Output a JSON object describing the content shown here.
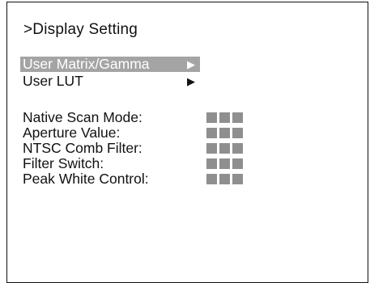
{
  "screen": {
    "title": ">Display Setting"
  },
  "menu": [
    {
      "label": "User Matrix/Gamma",
      "arrow": "▶",
      "selected": true
    },
    {
      "label": "User LUT",
      "arrow": "▶",
      "selected": false
    }
  ],
  "settings": [
    {
      "label": "Native Scan Mode:",
      "value_icon": "three-gray-blocks"
    },
    {
      "label": "Aperture Value:",
      "value_icon": "three-gray-blocks"
    },
    {
      "label": "NTSC Comb Filter:",
      "value_icon": "three-gray-blocks"
    },
    {
      "label": "Filter Switch:",
      "value_icon": "three-gray-blocks"
    },
    {
      "label": "Peak White Control:",
      "value_icon": "three-gray-blocks"
    }
  ],
  "colors": {
    "highlight": "#a4a4a4",
    "value_block": "#8f8f8f",
    "text": "#111111"
  }
}
